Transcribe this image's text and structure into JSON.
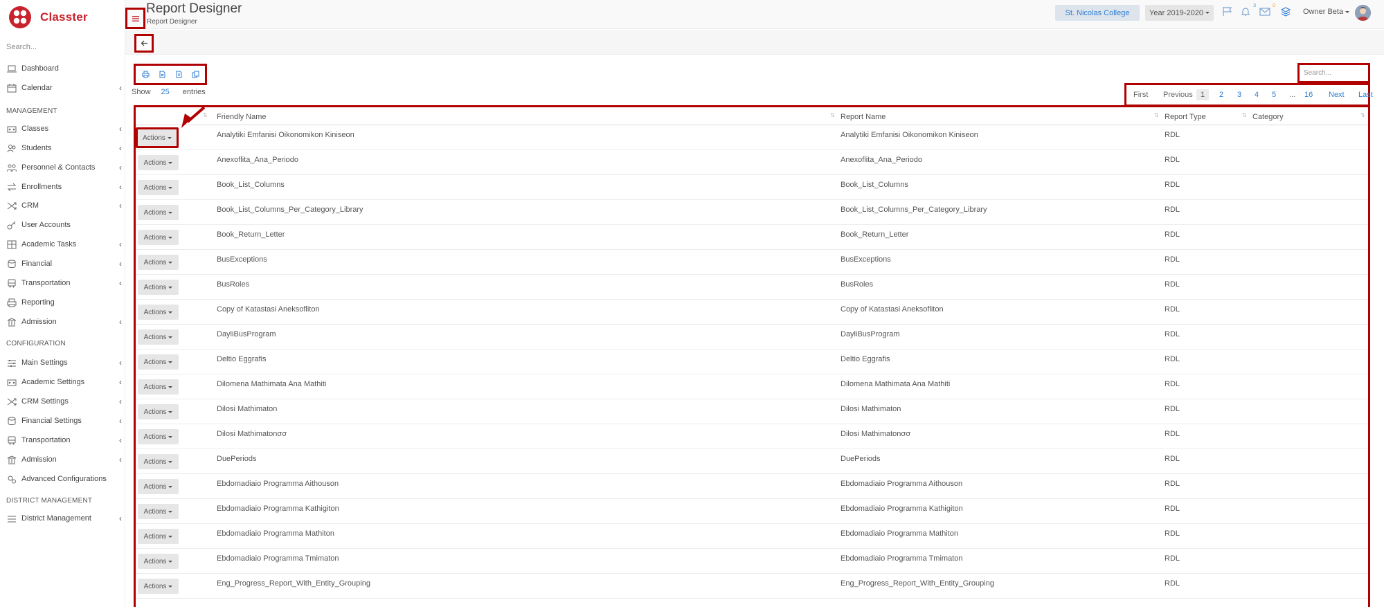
{
  "app": {
    "name": "Classter",
    "brand_color": "#c8232c",
    "highlight_color": "#b00000"
  },
  "sidebar": {
    "search_placeholder": "Search...",
    "items": [
      {
        "label": "Dashboard",
        "icon": "laptop-icon",
        "chevron": false
      },
      {
        "label": "Calendar",
        "icon": "calendar-icon",
        "chevron": true
      },
      {
        "label": "Classes",
        "icon": "classes-icon",
        "chevron": true
      },
      {
        "label": "Students",
        "icon": "students-icon",
        "chevron": true
      },
      {
        "label": "Personnel & Contacts",
        "icon": "personnel-icon",
        "chevron": true
      },
      {
        "label": "Enrollments",
        "icon": "enrollments-icon",
        "chevron": true
      },
      {
        "label": "CRM",
        "icon": "crm-icon",
        "chevron": true
      },
      {
        "label": "User Accounts",
        "icon": "key-icon",
        "chevron": false
      },
      {
        "label": "Academic Tasks",
        "icon": "grid-icon",
        "chevron": true
      },
      {
        "label": "Financial",
        "icon": "coins-icon",
        "chevron": true
      },
      {
        "label": "Transportation",
        "icon": "bus-icon",
        "chevron": true
      },
      {
        "label": "Reporting",
        "icon": "printer-icon",
        "chevron": false
      },
      {
        "label": "Admission",
        "icon": "bank-icon",
        "chevron": true
      },
      {
        "label": "Main Settings",
        "icon": "sliders-icon",
        "chevron": true
      },
      {
        "label": "Academic Settings",
        "icon": "classes-icon",
        "chevron": true
      },
      {
        "label": "CRM Settings",
        "icon": "crm-icon",
        "chevron": true
      },
      {
        "label": "Financial Settings",
        "icon": "coins-icon",
        "chevron": true
      },
      {
        "label": "Transportation",
        "icon": "bus-icon",
        "chevron": true
      },
      {
        "label": "Admission",
        "icon": "bank-icon",
        "chevron": true
      },
      {
        "label": "Advanced Configurations",
        "icon": "gears-icon",
        "chevron": false
      },
      {
        "label": "District Management",
        "icon": "list-icon",
        "chevron": true
      }
    ],
    "sections": {
      "management": "MANAGEMENT",
      "configuration": "CONFIGURATION",
      "district": "DISTRICT MANAGEMENT"
    }
  },
  "header": {
    "title": "Report Designer",
    "subtitle": "Report Designer",
    "college": "St. Nicolas College",
    "year": "Year 2019-2020",
    "notif_count": "3",
    "mail_count": "0",
    "user": "Owner Beta"
  },
  "toolbar": {
    "show_label": "Show",
    "entries_count": "25",
    "entries_label": "entries",
    "search_placeholder": "Search..."
  },
  "pagination": {
    "first": "First",
    "previous": "Previous",
    "pages": [
      "1",
      "2",
      "3",
      "4",
      "5"
    ],
    "ellipsis": "...",
    "last_page": "16",
    "next": "Next",
    "last": "Last",
    "current": "1"
  },
  "table": {
    "columns": [
      "Friendly Name",
      "Report Name",
      "Report Type",
      "Category"
    ],
    "action_label": "Actions",
    "rows": [
      {
        "friendly": "Analytiki Emfanisi Oikonomikon Kiniseon",
        "report": "Analytiki Emfanisi Oikonomikon Kiniseon",
        "type": "RDL",
        "category": ""
      },
      {
        "friendly": "Anexoflita_Ana_Periodo",
        "report": "Anexoflita_Ana_Periodo",
        "type": "RDL",
        "category": ""
      },
      {
        "friendly": "Book_List_Columns",
        "report": "Book_List_Columns",
        "type": "RDL",
        "category": ""
      },
      {
        "friendly": "Book_List_Columns_Per_Category_Library",
        "report": "Book_List_Columns_Per_Category_Library",
        "type": "RDL",
        "category": ""
      },
      {
        "friendly": "Book_Return_Letter",
        "report": "Book_Return_Letter",
        "type": "RDL",
        "category": ""
      },
      {
        "friendly": "BusExceptions",
        "report": "BusExceptions",
        "type": "RDL",
        "category": ""
      },
      {
        "friendly": "BusRoles",
        "report": "BusRoles",
        "type": "RDL",
        "category": ""
      },
      {
        "friendly": "Copy of Katastasi Aneksofliton",
        "report": "Copy of Katastasi Aneksofliton",
        "type": "RDL",
        "category": ""
      },
      {
        "friendly": "DayliBusProgram",
        "report": "DayliBusProgram",
        "type": "RDL",
        "category": ""
      },
      {
        "friendly": "Deltio Eggrafis",
        "report": "Deltio Eggrafis",
        "type": "RDL",
        "category": ""
      },
      {
        "friendly": "Dilomena Mathimata Ana Mathiti",
        "report": "Dilomena Mathimata Ana Mathiti",
        "type": "RDL",
        "category": ""
      },
      {
        "friendly": "Dilosi Mathimaton",
        "report": "Dilosi Mathimaton",
        "type": "RDL",
        "category": ""
      },
      {
        "friendly": "Dilosi Mathimatonσσ",
        "report": "Dilosi Mathimatonσσ",
        "type": "RDL",
        "category": ""
      },
      {
        "friendly": "DuePeriods",
        "report": "DuePeriods",
        "type": "RDL",
        "category": ""
      },
      {
        "friendly": "Ebdomadiaio Programma Aithouson",
        "report": "Ebdomadiaio Programma Aithouson",
        "type": "RDL",
        "category": ""
      },
      {
        "friendly": "Ebdomadiaio Programma Kathigiton",
        "report": "Ebdomadiaio Programma Kathigiton",
        "type": "RDL",
        "category": ""
      },
      {
        "friendly": "Ebdomadiaio Programma Mathiton",
        "report": "Ebdomadiaio Programma Mathiton",
        "type": "RDL",
        "category": ""
      },
      {
        "friendly": "Ebdomadiaio Programma Tmimaton",
        "report": "Ebdomadiaio Programma Tmimaton",
        "type": "RDL",
        "category": ""
      },
      {
        "friendly": "Eng_Progress_Report_With_Entity_Grouping",
        "report": "Eng_Progress_Report_With_Entity_Grouping",
        "type": "RDL",
        "category": ""
      }
    ]
  }
}
